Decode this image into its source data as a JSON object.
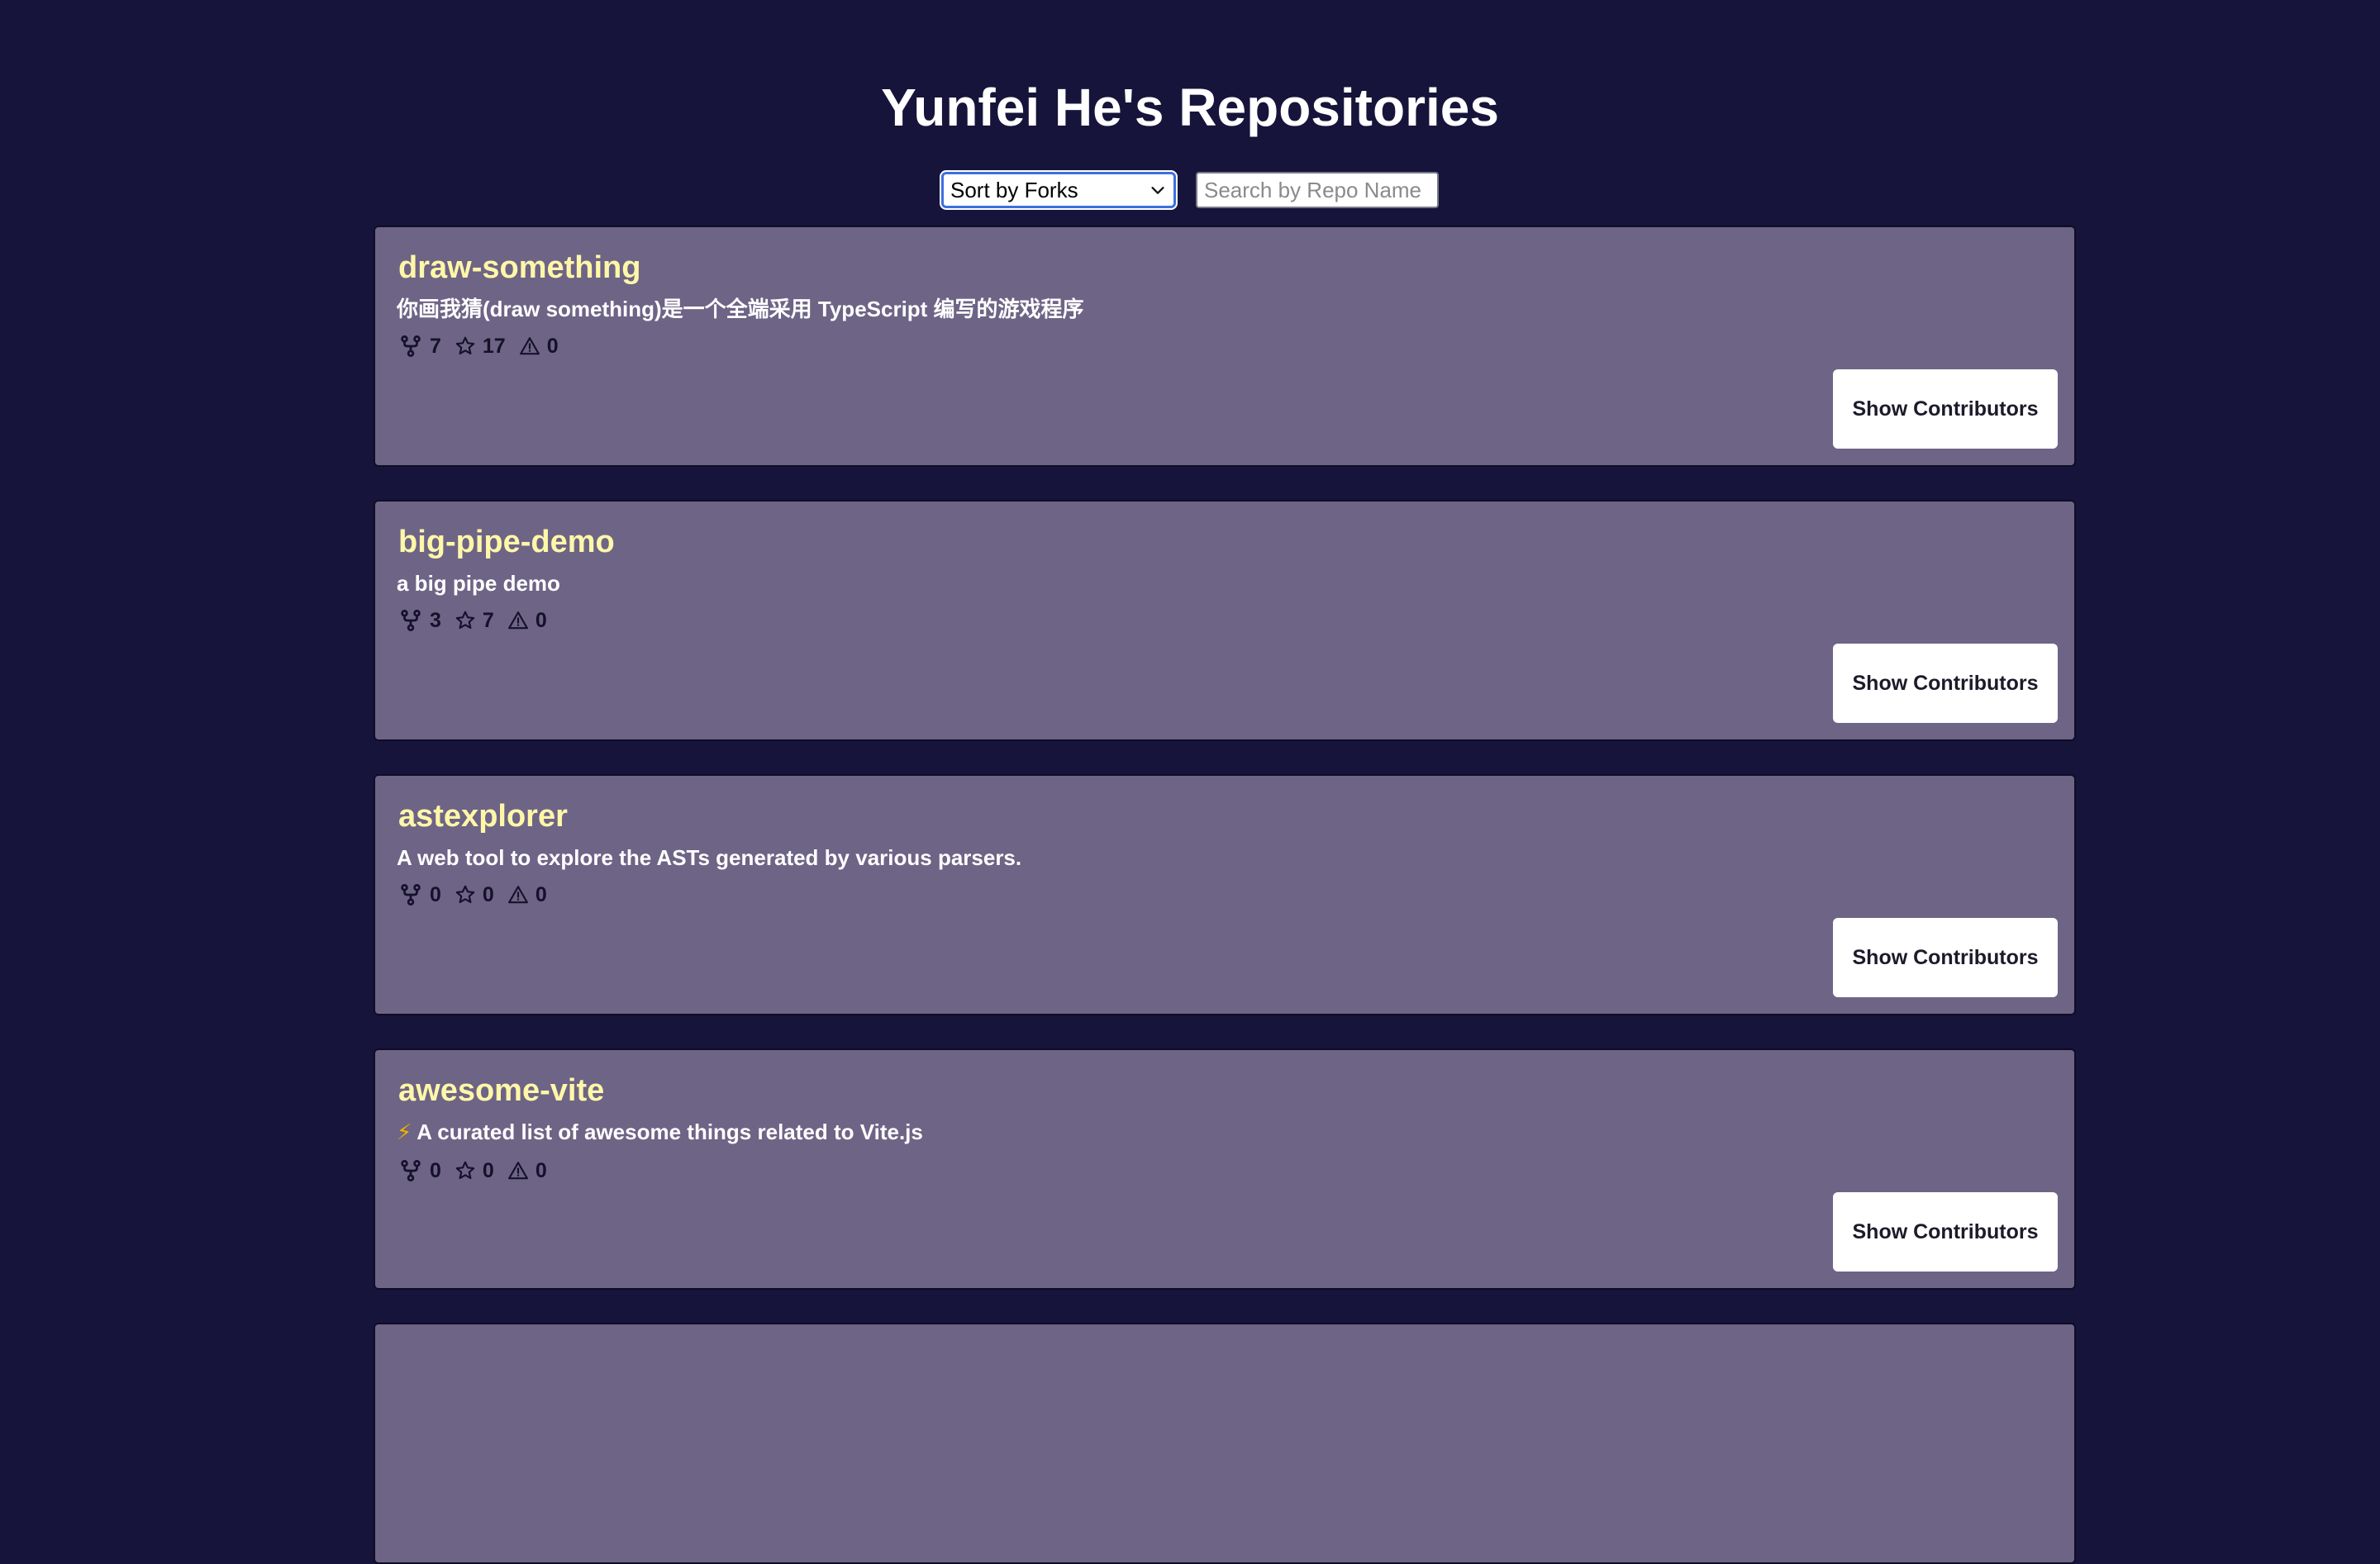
{
  "header": {
    "title": "Yunfei He's Repositories"
  },
  "controls": {
    "sort_selected": "Sort by Forks",
    "search_placeholder": "Search by Repo Name"
  },
  "repos": [
    {
      "name": "draw-something",
      "description": "你画我猜(draw something)是一个全端采用 TypeScript 编写的游戏程序",
      "forks": "7",
      "stars": "17",
      "issues": "0",
      "button_label": "Show Contributors"
    },
    {
      "name": "big-pipe-demo",
      "description": "a big pipe demo",
      "forks": "3",
      "stars": "7",
      "issues": "0",
      "button_label": "Show Contributors"
    },
    {
      "name": "astexplorer",
      "description": "A web tool to explore the ASTs generated by various parsers.",
      "forks": "0",
      "stars": "0",
      "issues": "0",
      "button_label": "Show Contributors"
    },
    {
      "name": "awesome-vite",
      "description_icon": "⚡",
      "description": "A curated list of awesome things related to Vite.js",
      "forks": "0",
      "stars": "0",
      "issues": "0",
      "button_label": "Show Contributors"
    }
  ]
}
